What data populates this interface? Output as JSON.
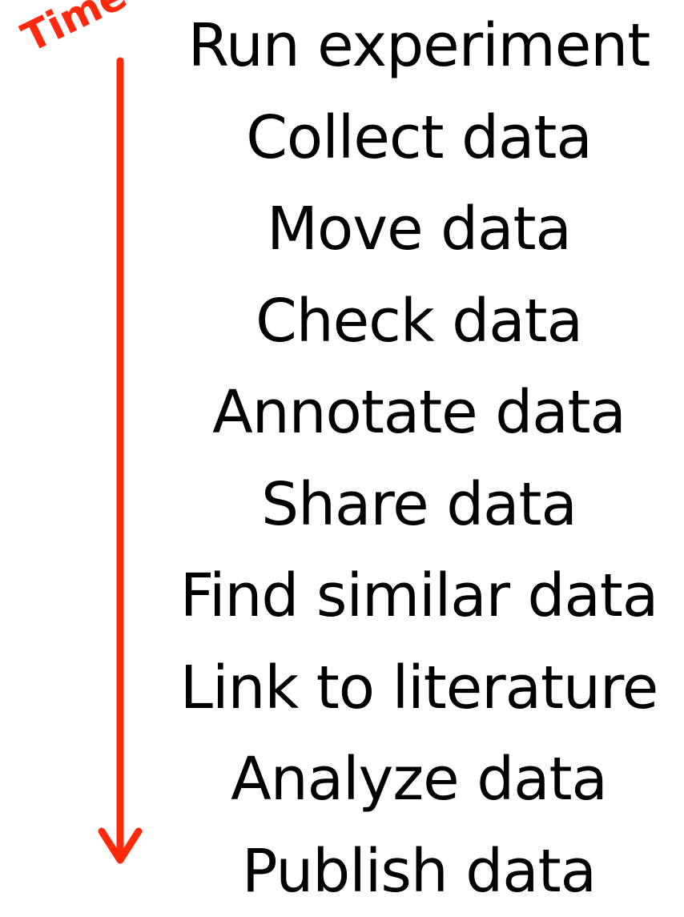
{
  "time_label": "Time",
  "colors": {
    "arrow": "#ff2a0d",
    "text": "#000000",
    "background": "#ffffff"
  },
  "steps": [
    "Run experiment",
    "Collect data",
    "Move data",
    "Check data",
    "Annotate data",
    "Share data",
    "Find similar data",
    "Link to literature",
    "Analyze data",
    "Publish data"
  ]
}
